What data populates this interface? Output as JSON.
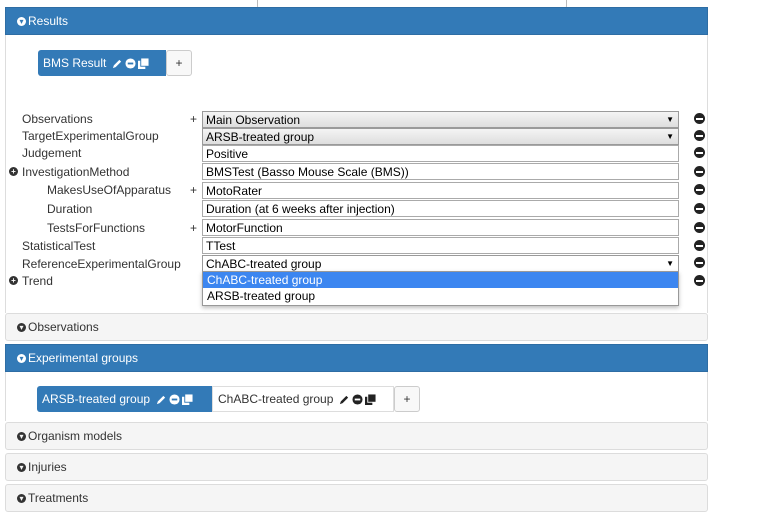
{
  "results": {
    "header": "Results",
    "tabs": [
      {
        "label": "BMS Result"
      }
    ],
    "add_label": "+"
  },
  "form": {
    "rows": [
      {
        "label": "Observations",
        "value": "Main Observation",
        "kind": "select",
        "plus": "+"
      },
      {
        "label": "TargetExperimentalGroup",
        "value": "ARSB-treated group",
        "kind": "select",
        "plus": ""
      },
      {
        "label": "Judgement",
        "value": "Positive",
        "kind": "text",
        "plus": ""
      },
      {
        "label": "InvestigationMethod",
        "value": "BMSTest (Basso Mouse Scale (BMS))",
        "kind": "text",
        "plus": ""
      },
      {
        "label": "MakesUseOfApparatus",
        "value": "MotoRater",
        "kind": "text",
        "plus": "+"
      },
      {
        "label": "Duration",
        "value": "Duration (at 6 weeks after injection)",
        "kind": "text",
        "plus": ""
      },
      {
        "label": "TestsForFunctions",
        "value": "MotorFunction",
        "kind": "text",
        "plus": "+"
      },
      {
        "label": "StatisticalTest",
        "value": "TTest",
        "kind": "text",
        "plus": ""
      },
      {
        "label": "ReferenceExperimentalGroup",
        "value": "ChABC-treated group",
        "kind": "select-open",
        "plus": ""
      },
      {
        "label": "Trend",
        "value": "",
        "kind": "none",
        "plus": ""
      }
    ],
    "dropdown_options": [
      "ChABC-treated group",
      "ARSB-treated group"
    ],
    "dropdown_selected": "ChABC-treated group"
  },
  "sections": {
    "observations": "Observations",
    "experimental_groups": "Experimental groups",
    "organism_models": "Organism models",
    "injuries": "Injuries",
    "treatments": "Treatments"
  },
  "groups": {
    "tabs": [
      {
        "label": "ARSB-treated group"
      },
      {
        "label": "ChABC-treated group"
      }
    ],
    "add_label": "+"
  },
  "colors": {
    "accent": "#337ab7",
    "dropdown_highlight": "#3c86f0"
  },
  "icons": [
    "pencil-icon",
    "minus-circle-icon",
    "copy-icon",
    "collapse-icon",
    "expand-icon"
  ]
}
